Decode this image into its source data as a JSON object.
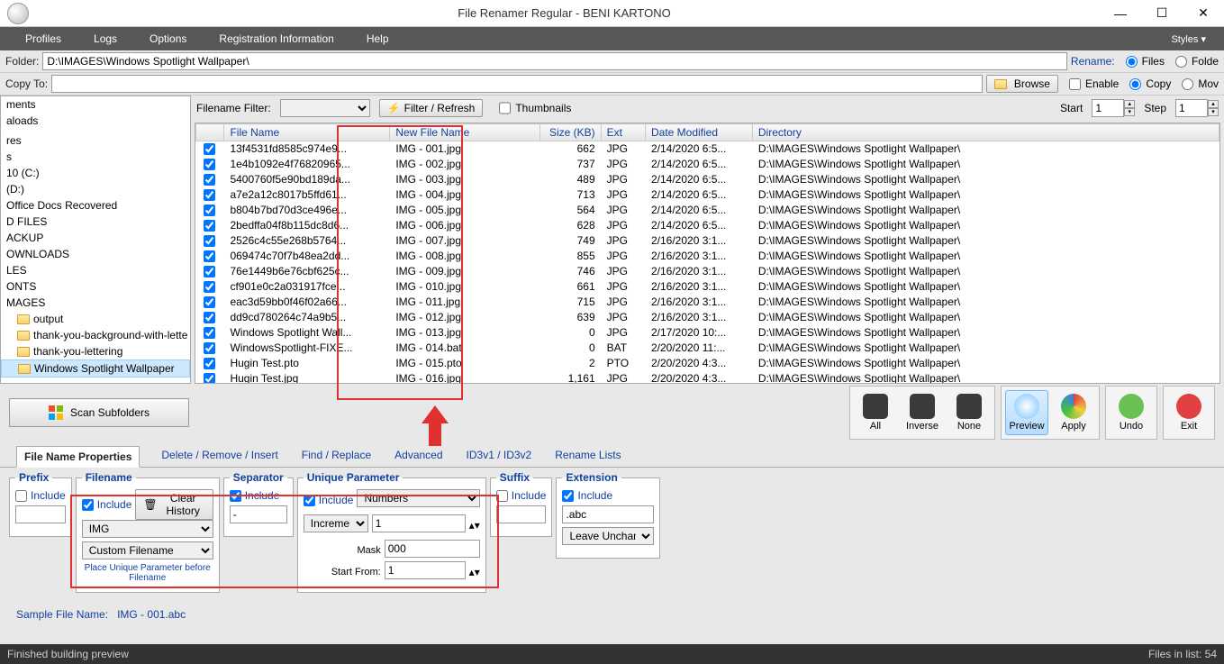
{
  "title": "File Renamer Regular - BENI KARTONO",
  "menu": [
    "Profiles",
    "Logs",
    "Options",
    "Registration Information",
    "Help"
  ],
  "styles_label": "Styles ▾",
  "folder_label": "Folder:",
  "folder_path": "D:\\IMAGES\\Windows Spotlight Wallpaper\\",
  "rename_label": "Rename:",
  "rename_files": "Files",
  "rename_folders": "Folde",
  "copyto_label": "Copy To:",
  "browse_label": "Browse",
  "enable_label": "Enable",
  "copy_opt": "Copy",
  "move_opt": "Mov",
  "filter_label": "Filename Filter:",
  "filter_refresh": "Filter / Refresh",
  "thumbnails": "Thumbnails",
  "start_label": "Start",
  "start_val": "1",
  "step_label": "Step",
  "step_val": "1",
  "tree": [
    {
      "t": "ments",
      "i": 0
    },
    {
      "t": "aloads",
      "i": 0
    },
    {
      "t": "",
      "i": 0
    },
    {
      "t": "res",
      "i": 0
    },
    {
      "t": "s",
      "i": 0
    },
    {
      "t": "10 (C:)",
      "i": 0
    },
    {
      "t": " (D:)",
      "i": 0
    },
    {
      "t": "Office Docs Recovered",
      "i": 0
    },
    {
      "t": "D FILES",
      "i": 0
    },
    {
      "t": "ACKUP",
      "i": 0
    },
    {
      "t": "OWNLOADS",
      "i": 0
    },
    {
      "t": "LES",
      "i": 0
    },
    {
      "t": "ONTS",
      "i": 0
    },
    {
      "t": "MAGES",
      "i": 0
    },
    {
      "t": "output",
      "i": 1
    },
    {
      "t": "thank-you-background-with-lette",
      "i": 1
    },
    {
      "t": "thank-you-lettering",
      "i": 1
    },
    {
      "t": "Windows Spotlight Wallpaper",
      "i": 1,
      "sel": true
    }
  ],
  "columns": [
    "",
    "File Name",
    "New File Name",
    "Size (KB)",
    "Ext",
    "Date Modified",
    "Directory"
  ],
  "rows": [
    {
      "fn": "13f4531fd8585c974e9...",
      "nf": "IMG - 001.jpg",
      "sz": "662",
      "ext": "JPG",
      "dm": "2/14/2020 6:5...",
      "dir": "D:\\IMAGES\\Windows Spotlight Wallpaper\\"
    },
    {
      "fn": "1e4b1092e4f76820965...",
      "nf": "IMG - 002.jpg",
      "sz": "737",
      "ext": "JPG",
      "dm": "2/14/2020 6:5...",
      "dir": "D:\\IMAGES\\Windows Spotlight Wallpaper\\"
    },
    {
      "fn": "5400760f5e90bd189da...",
      "nf": "IMG - 003.jpg",
      "sz": "489",
      "ext": "JPG",
      "dm": "2/14/2020 6:5...",
      "dir": "D:\\IMAGES\\Windows Spotlight Wallpaper\\"
    },
    {
      "fn": "a7e2a12c8017b5ffd61...",
      "nf": "IMG - 004.jpg",
      "sz": "713",
      "ext": "JPG",
      "dm": "2/14/2020 6:5...",
      "dir": "D:\\IMAGES\\Windows Spotlight Wallpaper\\"
    },
    {
      "fn": "b804b7bd70d3ce496e...",
      "nf": "IMG - 005.jpg",
      "sz": "564",
      "ext": "JPG",
      "dm": "2/14/2020 6:5...",
      "dir": "D:\\IMAGES\\Windows Spotlight Wallpaper\\"
    },
    {
      "fn": "2bedffa04f8b115dc8d6...",
      "nf": "IMG - 006.jpg",
      "sz": "628",
      "ext": "JPG",
      "dm": "2/14/2020 6:5...",
      "dir": "D:\\IMAGES\\Windows Spotlight Wallpaper\\"
    },
    {
      "fn": "2526c4c55e268b5764...",
      "nf": "IMG - 007.jpg",
      "sz": "749",
      "ext": "JPG",
      "dm": "2/16/2020 3:1...",
      "dir": "D:\\IMAGES\\Windows Spotlight Wallpaper\\"
    },
    {
      "fn": "069474c70f7b48ea2dd...",
      "nf": "IMG - 008.jpg",
      "sz": "855",
      "ext": "JPG",
      "dm": "2/16/2020 3:1...",
      "dir": "D:\\IMAGES\\Windows Spotlight Wallpaper\\"
    },
    {
      "fn": "76e1449b6e76cbf625c...",
      "nf": "IMG - 009.jpg",
      "sz": "746",
      "ext": "JPG",
      "dm": "2/16/2020 3:1...",
      "dir": "D:\\IMAGES\\Windows Spotlight Wallpaper\\"
    },
    {
      "fn": "cf901e0c2a031917fce...",
      "nf": "IMG - 010.jpg",
      "sz": "661",
      "ext": "JPG",
      "dm": "2/16/2020 3:1...",
      "dir": "D:\\IMAGES\\Windows Spotlight Wallpaper\\"
    },
    {
      "fn": "eac3d59bb0f46f02a66...",
      "nf": "IMG - 011.jpg",
      "sz": "715",
      "ext": "JPG",
      "dm": "2/16/2020 3:1...",
      "dir": "D:\\IMAGES\\Windows Spotlight Wallpaper\\"
    },
    {
      "fn": "dd9cd780264c74a9b5...",
      "nf": "IMG - 012.jpg",
      "sz": "639",
      "ext": "JPG",
      "dm": "2/16/2020 3:1...",
      "dir": "D:\\IMAGES\\Windows Spotlight Wallpaper\\"
    },
    {
      "fn": "Windows Spotlight Wall...",
      "nf": "IMG - 013.jpg",
      "sz": "0",
      "ext": "JPG",
      "dm": "2/17/2020 10:...",
      "dir": "D:\\IMAGES\\Windows Spotlight Wallpaper\\"
    },
    {
      "fn": "WindowsSpotlight-FIXE...",
      "nf": "IMG - 014.bat",
      "sz": "0",
      "ext": "BAT",
      "dm": "2/20/2020 11:...",
      "dir": "D:\\IMAGES\\Windows Spotlight Wallpaper\\"
    },
    {
      "fn": "Hugin Test.pto",
      "nf": "IMG - 015.pto",
      "sz": "2",
      "ext": "PTO",
      "dm": "2/20/2020 4:3...",
      "dir": "D:\\IMAGES\\Windows Spotlight Wallpaper\\"
    },
    {
      "fn": "Hugin Test.jpg",
      "nf": "IMG - 016.jpg",
      "sz": "1,161",
      "ext": "JPG",
      "dm": "2/20/2020 4:3...",
      "dir": "D:\\IMAGES\\Windows Spotlight Wallpaper\\"
    }
  ],
  "scan_subfolders": "Scan Subfolders",
  "big_btns": {
    "all": "All",
    "inverse": "Inverse",
    "none": "None",
    "preview": "Preview",
    "apply": "Apply",
    "undo": "Undo",
    "exit": "Exit"
  },
  "tabs": [
    "File Name Properties",
    "Delete / Remove / Insert",
    "Find / Replace",
    "Advanced",
    "ID3v1 / ID3v2",
    "Rename Lists"
  ],
  "prefix": {
    "legend": "Prefix",
    "include": "Include"
  },
  "filename": {
    "legend": "Filename",
    "include": "Include",
    "clear": "Clear History",
    "value": "IMG",
    "mode": "Custom Filename",
    "place": "Place Unique Parameter before Filename"
  },
  "separator": {
    "legend": "Separator",
    "include": "Include",
    "value": "-"
  },
  "unique": {
    "legend": "Unique Parameter",
    "include": "Include",
    "type": "Numbers",
    "mode": "Increment",
    "start": "1",
    "mask": "000",
    "mask_label": "Mask",
    "from_label": "Start From:",
    "from": "1"
  },
  "suffix": {
    "legend": "Suffix",
    "include": "Include"
  },
  "ext": {
    "legend": "Extension",
    "include": "Include",
    "value": ".abc",
    "mode": "Leave Unchanged"
  },
  "sample_label": "Sample File Name:",
  "sample_value": "IMG - 001.abc",
  "status_left": "Finished building preview",
  "status_right": "Files in list: 54"
}
